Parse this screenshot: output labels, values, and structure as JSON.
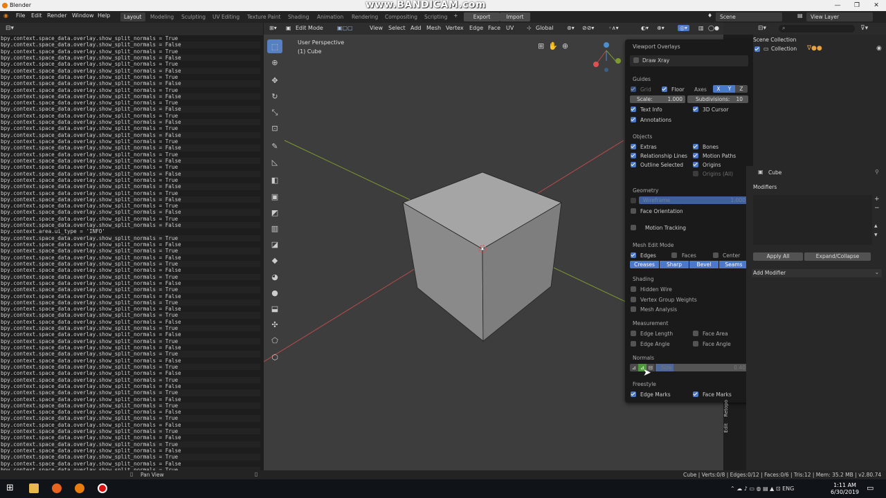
{
  "app_title": "Blender",
  "watermark": "www.BANDICAM.com",
  "window_controls": [
    "—",
    "❐",
    "✕"
  ],
  "menus": [
    "File",
    "Edit",
    "Render",
    "Window",
    "Help"
  ],
  "workspaces": [
    "Layout",
    "Modeling",
    "Sculpting",
    "UV Editing",
    "Texture Paint",
    "Shading",
    "Animation",
    "Rendering",
    "Compositing",
    "Scripting"
  ],
  "export_label": "Export",
  "import_label": "Import",
  "scene_label": "Scene",
  "view_layer_label": "View Layer",
  "info_log": [
    "bpy.context.space_data.overlay.show_split_normals = True",
    "bpy.context.space_data.overlay.show_split_normals = False",
    "bpy.context.space_data.overlay.show_split_normals = True",
    "bpy.context.space_data.overlay.show_split_normals = False",
    "bpy.context.space_data.overlay.show_split_normals = True",
    "bpy.context.space_data.overlay.show_split_normals = False",
    "bpy.context.space_data.overlay.show_split_normals = True",
    "bpy.context.space_data.overlay.show_split_normals = False",
    "bpy.context.space_data.overlay.show_split_normals = True",
    "bpy.context.space_data.overlay.show_split_normals = False",
    "bpy.context.space_data.overlay.show_split_normals = True",
    "bpy.context.space_data.overlay.show_split_normals = False",
    "bpy.context.space_data.overlay.show_split_normals = True",
    "bpy.context.space_data.overlay.show_split_normals = False",
    "bpy.context.space_data.overlay.show_split_normals = True",
    "bpy.context.space_data.overlay.show_split_normals = False",
    "bpy.context.space_data.overlay.show_split_normals = True",
    "bpy.context.space_data.overlay.show_split_normals = False",
    "bpy.context.space_data.overlay.show_split_normals = True",
    "bpy.context.space_data.overlay.show_split_normals = False",
    "bpy.context.space_data.overlay.show_split_normals = True",
    "bpy.context.space_data.overlay.show_split_normals = False",
    "bpy.context.space_data.overlay.show_split_normals = True",
    "bpy.context.space_data.overlay.show_split_normals = False",
    "bpy.context.space_data.overlay.show_split_normals = True",
    "bpy.context.space_data.overlay.show_split_normals = False",
    "bpy.context.space_data.overlay.show_split_normals = True",
    "bpy.context.space_data.overlay.show_split_normals = False",
    "bpy.context.space_data.overlay.show_split_normals = True",
    "bpy.context.space_data.overlay.show_split_normals = False",
    "bpy.context.area.ui_type = 'INFO'",
    "bpy.context.space_data.overlay.show_split_normals = True",
    "bpy.context.space_data.overlay.show_split_normals = False",
    "bpy.context.space_data.overlay.show_split_normals = True",
    "bpy.context.space_data.overlay.show_split_normals = False",
    "bpy.context.space_data.overlay.show_split_normals = True",
    "bpy.context.space_data.overlay.show_split_normals = False",
    "bpy.context.space_data.overlay.show_split_normals = True",
    "bpy.context.space_data.overlay.show_split_normals = False",
    "bpy.context.space_data.overlay.show_split_normals = True",
    "bpy.context.space_data.overlay.show_split_normals = False",
    "bpy.context.space_data.overlay.show_split_normals = True",
    "bpy.context.space_data.overlay.show_split_normals = False",
    "bpy.context.space_data.overlay.show_split_normals = True",
    "bpy.context.space_data.overlay.show_split_normals = False",
    "bpy.context.space_data.overlay.show_split_normals = True",
    "bpy.context.space_data.overlay.show_split_normals = False",
    "bpy.context.space_data.overlay.show_split_normals = True",
    "bpy.context.space_data.overlay.show_split_normals = False",
    "bpy.context.space_data.overlay.show_split_normals = True",
    "bpy.context.space_data.overlay.show_split_normals = False",
    "bpy.context.space_data.overlay.show_split_normals = True",
    "bpy.context.space_data.overlay.show_split_normals = False",
    "bpy.context.space_data.overlay.show_split_normals = True",
    "bpy.context.space_data.overlay.show_split_normals = False",
    "bpy.context.space_data.overlay.show_split_normals = True",
    "bpy.context.space_data.overlay.show_split_normals = False",
    "bpy.context.space_data.overlay.show_split_normals = True",
    "bpy.context.space_data.overlay.show_split_normals = False",
    "bpy.context.space_data.overlay.show_split_normals = True",
    "bpy.context.space_data.overlay.show_split_normals = False",
    "bpy.context.space_data.overlay.show_split_normals = True",
    "bpy.context.space_data.overlay.show_split_normals = False",
    "bpy.context.space_data.overlay.show_split_normals = True",
    "bpy.context.space_data.overlay.show_split_normals = False",
    "bpy.context.space_data.overlay.show_split_normals = True",
    "bpy.context.space_data.overlay.show_split_normals = False",
    "bpy.context.space_data.overlay.show_split_normals = True",
    "bpy.context.space_data.overlay.show_split_normals = False"
  ],
  "viewport": {
    "mode": "Edit Mode",
    "menus": [
      "View",
      "Select",
      "Add",
      "Mesh",
      "Vertex",
      "Edge",
      "Face",
      "UV"
    ],
    "orientation": "Global",
    "perspective": "User Perspective",
    "object": "(1) Cube",
    "gizmo_axes": [
      "X",
      "Y",
      "Z"
    ],
    "tools": [
      "select-box-icon",
      "cursor-icon",
      "move-icon",
      "rotate-icon",
      "scale-icon",
      "transform-icon",
      "annotate-icon",
      "measure-icon",
      "extrude-icon",
      "inset-icon",
      "bevel-icon",
      "loop-cut-icon",
      "knife-icon",
      "poly-build-icon",
      "spin-icon",
      "smooth-icon",
      "edge-slide-icon",
      "shrink-icon",
      "shear-icon",
      "rip-icon"
    ]
  },
  "overlays": {
    "title": "Viewport Overlays",
    "draw_xray": "Draw Xray",
    "guides": {
      "header": "Guides",
      "grid": "Grid",
      "floor": "Floor",
      "axes": "Axes",
      "x": "X",
      "y": "Y",
      "z": "Z",
      "scale_label": "Scale:",
      "scale_value": "1.000",
      "subdiv_label": "Subdivisions:",
      "subdiv_value": "10",
      "text_info": "Text Info",
      "cursor3d": "3D Cursor",
      "annotations": "Annotations"
    },
    "objects": {
      "header": "Objects",
      "extras": "Extras",
      "bones": "Bones",
      "relationship_lines": "Relationship Lines",
      "motion_paths": "Motion Paths",
      "outline_selected": "Outline Selected",
      "origins": "Origins",
      "origins_all": "Origins (All)"
    },
    "geometry": {
      "header": "Geometry",
      "wireframe": "Wireframe",
      "wireframe_value": "1.000",
      "face_orientation": "Face Orientation",
      "motion_tracking": "Motion Tracking"
    },
    "mesh_edit": {
      "header": "Mesh Edit Mode",
      "edges": "Edges",
      "faces": "Faces",
      "center": "Center",
      "creases": "Creases",
      "sharp": "Sharp",
      "bevel": "Bevel",
      "seams": "Seams"
    },
    "shading": {
      "header": "Shading",
      "hidden_wire": "Hidden Wire",
      "vertex_group_weights": "Vertex Group Weights",
      "mesh_analysis": "Mesh Analysis"
    },
    "measurement": {
      "header": "Measurement",
      "edge_length": "Edge Length",
      "face_area": "Face Area",
      "edge_angle": "Edge Angle",
      "face_angle": "Face Angle"
    },
    "normals": {
      "header": "Normals",
      "size_label": "Size",
      "size_value": "0.40"
    },
    "freestyle": {
      "header": "Freestyle",
      "edge_marks": "Edge Marks",
      "face_marks": "Face Marks"
    }
  },
  "outliner": {
    "root": "Scene Collection",
    "collection": "Collection"
  },
  "properties": {
    "object": "Cube",
    "modifiers": "Modifiers",
    "apply_all": "Apply All",
    "expand_collapse": "Expand/Collapse",
    "add_modifier": "Add Modifier",
    "side_tabs": [
      "Retopo",
      "Edit"
    ]
  },
  "status": {
    "left": "Pan View",
    "right": "Cube | Verts:0/8 | Edges:0/12 | Faces:0/6 | Tris:12 | Mem: 35.2 MB | v2.80.74"
  },
  "taskbar": {
    "lang": "ENG",
    "time": "1:11 AM",
    "date": "6/30/2019"
  },
  "colors": {
    "accent": "#4b78c8",
    "viewport_bg": "#3d3d3d",
    "axis_x": "#b84b4b",
    "axis_y": "#7d9a2e"
  }
}
